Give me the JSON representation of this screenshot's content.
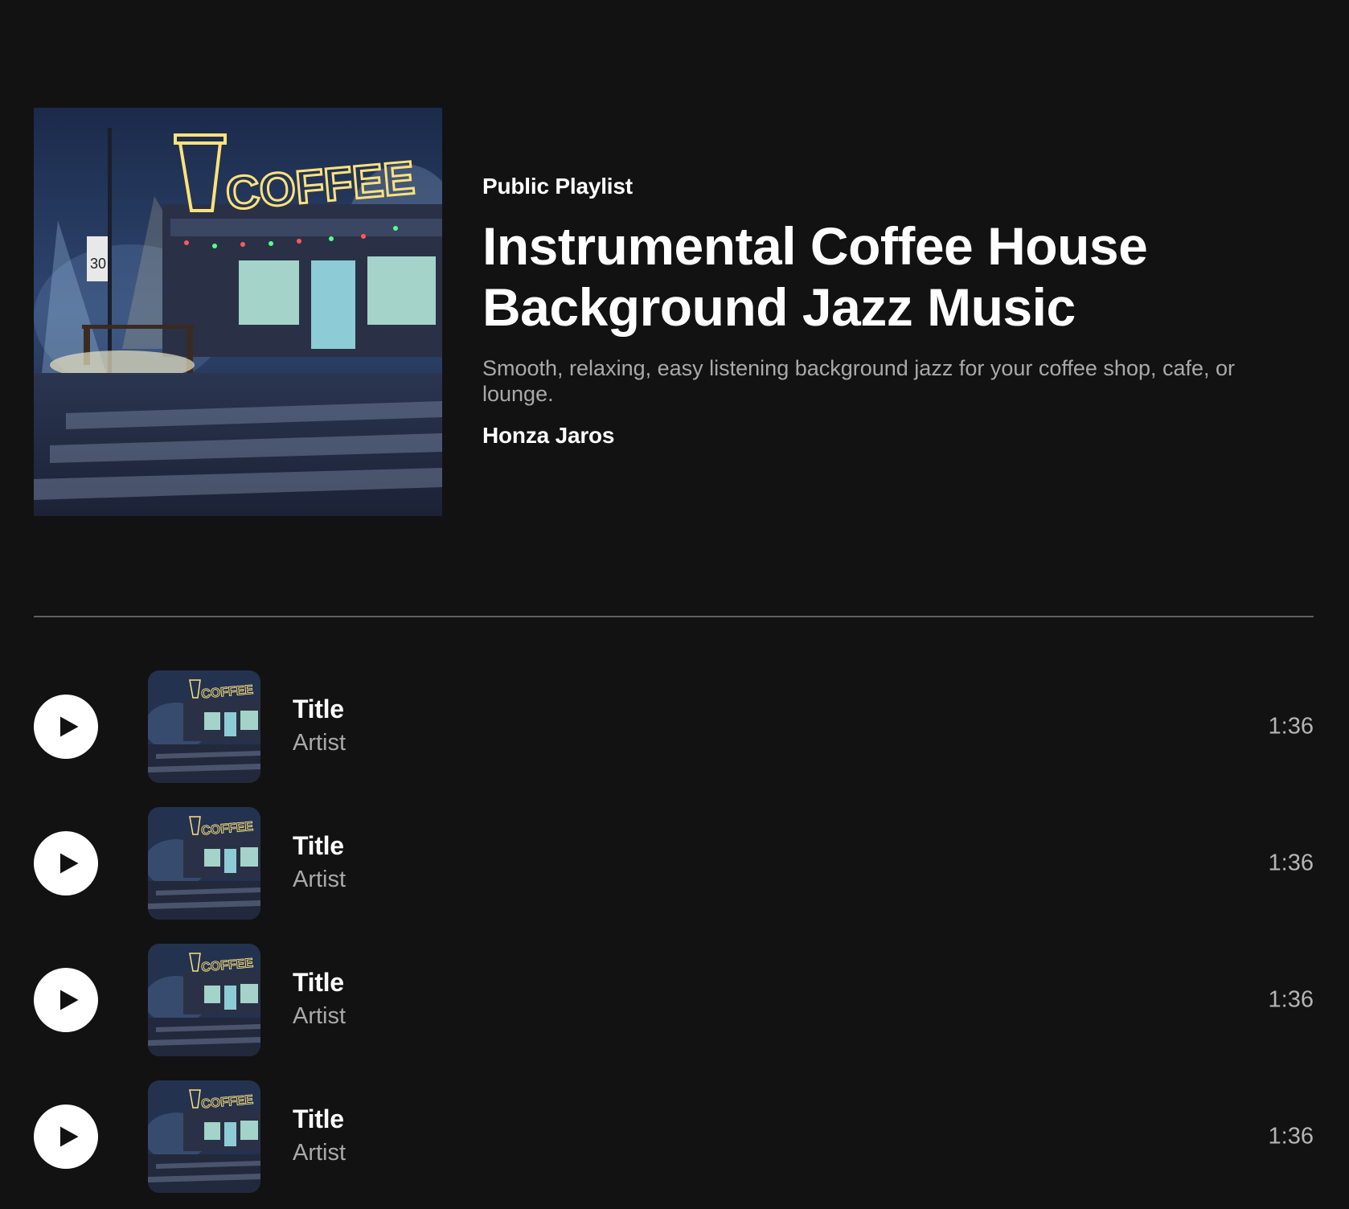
{
  "playlist": {
    "kicker": "Public Playlist",
    "title": "Instrumental Coffee House Background Jazz Music",
    "description": "Smooth, relaxing, easy listening background jazz for your coffee shop, cafe, or lounge.",
    "owner": "Honza Jaros",
    "cover_sign_text": "COFFEE"
  },
  "tracks": [
    {
      "title": "Title",
      "artist": "Artist",
      "duration": "1:36"
    },
    {
      "title": "Title",
      "artist": "Artist",
      "duration": "1:36"
    },
    {
      "title": "Title",
      "artist": "Artist",
      "duration": "1:36"
    },
    {
      "title": "Title",
      "artist": "Artist",
      "duration": "1:36"
    }
  ],
  "icons": {
    "play": "play-icon"
  },
  "colors": {
    "background": "#121212",
    "text_primary": "#ffffff",
    "text_secondary": "#a9a9a9",
    "divider": "#5f5f5f",
    "neon": "#ffe27a"
  }
}
